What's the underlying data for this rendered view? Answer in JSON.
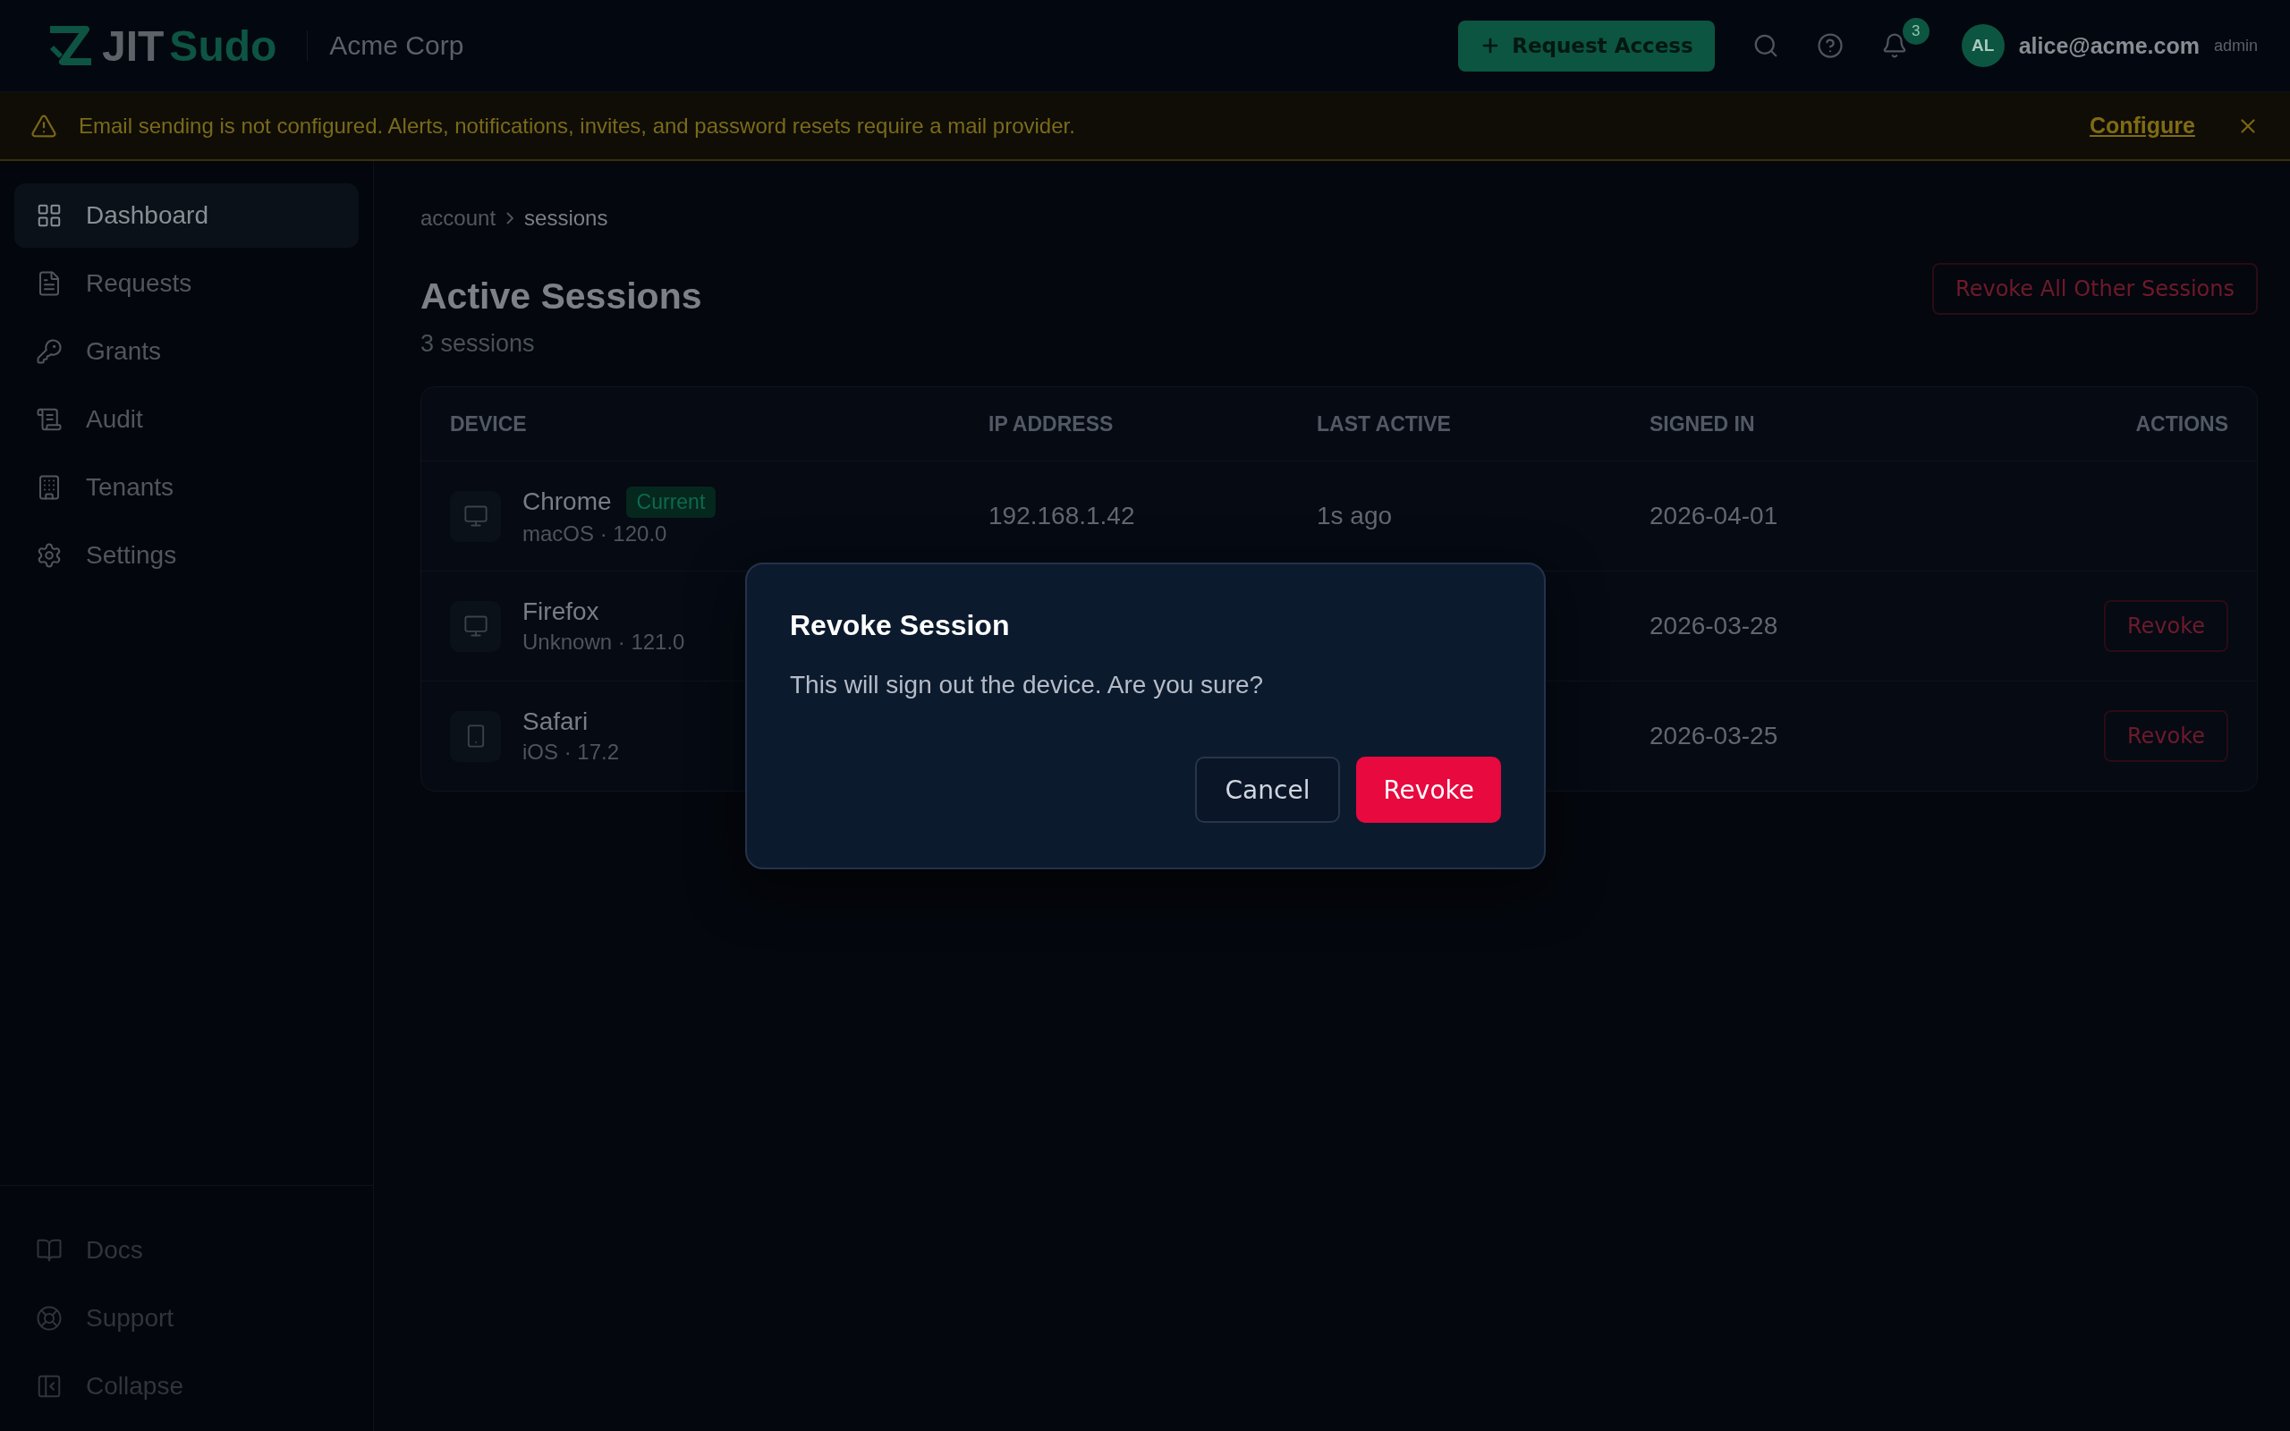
{
  "header": {
    "logo": {
      "part_1": "JIT",
      "part_2": "Sudo"
    },
    "org": "Acme Corp",
    "request_button": "Request Access",
    "notifications_count": "3",
    "user": {
      "initials": "AL",
      "email": "alice@acme.com",
      "role": "admin"
    }
  },
  "banner": {
    "message": "Email sending is not configured. Alerts, notifications, invites, and password resets require a mail provider.",
    "link": "Configure"
  },
  "sidebar": {
    "items": [
      {
        "label": "Dashboard",
        "selected": true
      },
      {
        "label": "Requests",
        "selected": false
      },
      {
        "label": "Grants",
        "selected": false
      },
      {
        "label": "Audit",
        "selected": false
      },
      {
        "label": "Tenants",
        "selected": false
      },
      {
        "label": "Settings",
        "selected": false
      }
    ],
    "footer_items": [
      {
        "label": "Docs"
      },
      {
        "label": "Support"
      },
      {
        "label": "Collapse"
      }
    ]
  },
  "breadcrumb": [
    "account",
    "sessions"
  ],
  "page": {
    "title": "Active Sessions",
    "subtitle": "3 sessions",
    "revoke_all_button": "Revoke All Other Sessions"
  },
  "table": {
    "columns": [
      "DEVICE",
      "IP ADDRESS",
      "LAST ACTIVE",
      "SIGNED IN",
      "ACTIONS"
    ],
    "rows": [
      {
        "device": "Chrome",
        "kind": "desktop",
        "badge": "Current",
        "detail": "macOS · 120.0",
        "ip": "192.168.1.42",
        "last_active": "1s ago",
        "signed_in": "2026-04-01"
      },
      {
        "device": "Firefox",
        "kind": "desktop",
        "detail": "Unknown · 121.0",
        "signed_in": "2026-03-28",
        "action": "Revoke"
      },
      {
        "device": "Safari",
        "kind": "phone",
        "detail": "iOS · 17.2",
        "signed_in": "2026-03-25",
        "action": "Revoke"
      }
    ]
  },
  "dialog": {
    "title": "Revoke Session",
    "message": "This will sign out the device. Are you sure?",
    "cancel_button": "Cancel",
    "confirm_button": "Revoke"
  }
}
